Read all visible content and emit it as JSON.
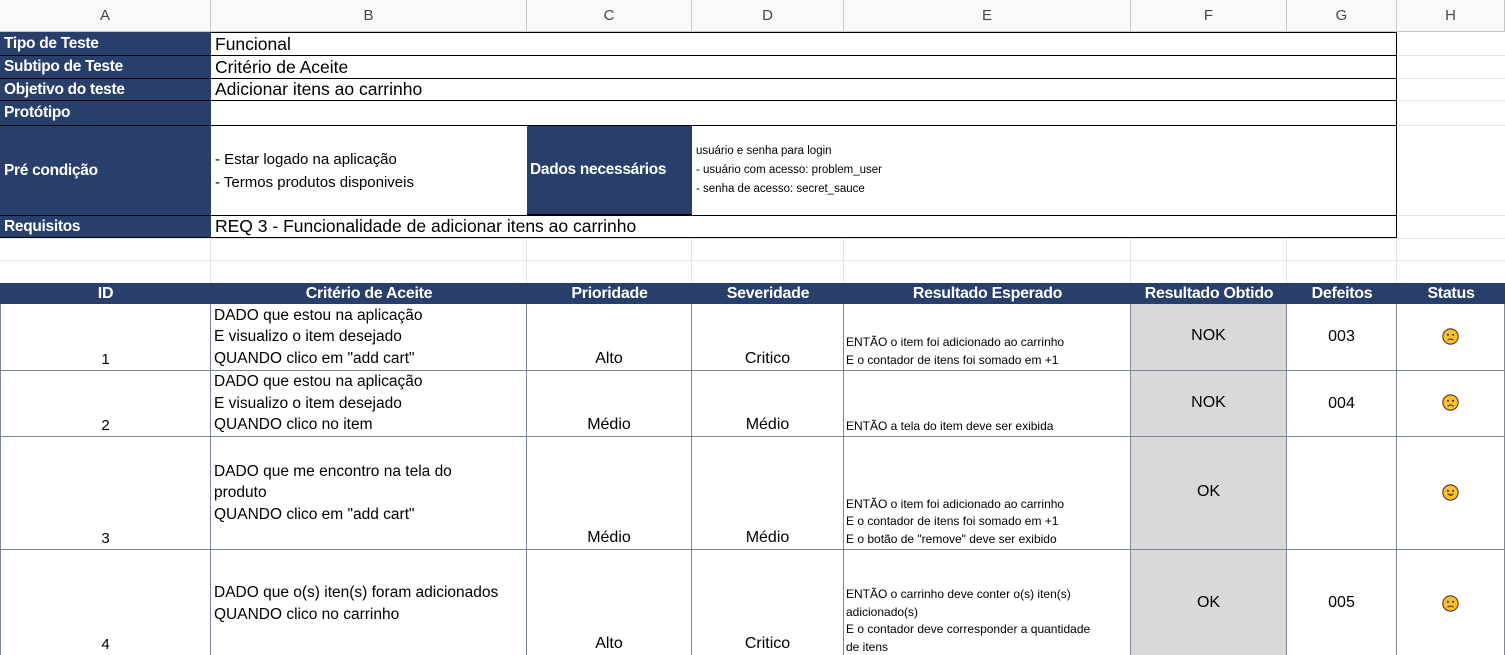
{
  "columns": [
    "A",
    "B",
    "C",
    "D",
    "E",
    "F",
    "G",
    "H"
  ],
  "info": {
    "tipo_label": "Tipo de Teste",
    "tipo_value": "Funcional",
    "subtipo_label": "Subtipo de Teste",
    "subtipo_value": "Critério de Aceite",
    "objetivo_label": "Objetivo do teste",
    "objetivo_value": "Adicionar itens ao carrinho",
    "prototipo_label": "Protótipo",
    "prototipo_value": "",
    "precondicao_label": "Pré condição",
    "precondicao_value": "- Estar logado na aplicação\n- Termos produtos disponiveis",
    "dados_label": "Dados necessários",
    "dados_value": "usuário e senha para login\n- usuário com acesso: problem_user\n- senha de acesso: secret_sauce",
    "requisitos_label": "Requisitos",
    "requisitos_value": "REQ 3 - Funcionalidade de adicionar itens ao carrinho"
  },
  "table": {
    "headers": [
      "ID",
      "Critério de Aceite",
      "Prioridade",
      "Severidade",
      "Resultado Esperado",
      "Resultado Obtido",
      "Defeitos",
      "Status"
    ],
    "rows": [
      {
        "id": "1",
        "criterio": "DADO que estou na aplicação\nE visualizo o item desejado\nQUANDO clico em \"add cart\"",
        "prioridade": "Alto",
        "severidade": "Critico",
        "esperado": "ENTÃO o item foi adicionado ao carrinho\nE o contador de itens foi somado em +1",
        "obtido": "NOK",
        "defeitos": "003",
        "status": "sad-face-icon"
      },
      {
        "id": "2",
        "criterio": "DADO que estou na aplicação\nE visualizo o item desejado\nQUANDO clico no item",
        "prioridade": "Médio",
        "severidade": "Médio",
        "esperado": "ENTÃO a tela do item deve ser exibida",
        "obtido": "NOK",
        "defeitos": "004",
        "status": "sad-face-icon"
      },
      {
        "id": "3",
        "criterio": "DADO que me encontro na tela do\nproduto\nQUANDO clico em \"add cart\"",
        "prioridade": "Médio",
        "severidade": "Médio",
        "esperado": "ENTÃO o item foi adicionado ao carrinho\nE o contador de itens foi somado em +1\nE o botão de \"remove\" deve ser exibido",
        "obtido": "OK",
        "defeitos": "",
        "status": "happy-face-icon"
      },
      {
        "id": "4",
        "criterio": "DADO que o(s) iten(s) foram adicionados\nQUANDO clico no carrinho",
        "prioridade": "Alto",
        "severidade": "Critico",
        "esperado": "ENTÃO o carrinho deve conter o(s) iten(s)\nadicionado(s)\nE o contador deve corresponder a quantidade\nde itens",
        "obtido": "OK",
        "defeitos": "005",
        "status": "sad-face-icon"
      }
    ]
  },
  "colors": {
    "header_bg": "#283f6c",
    "header_text": "#ffffff",
    "obtido_bg": "#d9d9d9",
    "face_fill": "#fbc02d"
  }
}
